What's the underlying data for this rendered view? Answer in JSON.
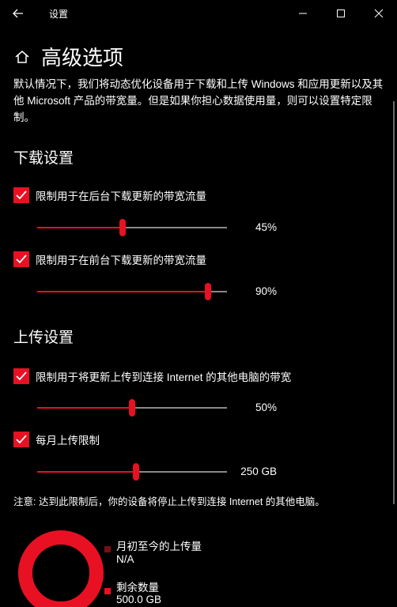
{
  "window": {
    "title": "设置"
  },
  "page": {
    "title": "高级选项",
    "description": "默认情况下，我们将动态优化设备用于下载和上传 Windows 和应用更新以及其他 Microsoft 产品的带宽量。但是如果你担心数据使用量，则可以设置特定限制。"
  },
  "download": {
    "section_title": "下载设置",
    "background": {
      "checked": true,
      "label": "限制用于在后台下载更新的带宽流量",
      "percent": 45,
      "value_text": "45%"
    },
    "foreground": {
      "checked": true,
      "label": "限制用于在前台下载更新的带宽流量",
      "percent": 90,
      "value_text": "90%"
    }
  },
  "upload": {
    "section_title": "上传设置",
    "bandwidth": {
      "checked": true,
      "label": "限制用于将更新上传到连接 Internet 的其他电脑的带宽",
      "percent": 50,
      "value_text": "50%"
    },
    "monthly": {
      "checked": true,
      "label": "每月上传限制",
      "fraction": 0.52,
      "value_text": "250 GB"
    },
    "note": "注意: 达到此限制后，你的设备将停止上传到连接 Internet 的其他电脑。"
  },
  "usage": {
    "uploaded_label": "月初至今的上传量",
    "uploaded_value": "N/A",
    "remaining_label": "剩余数量",
    "remaining_value": "500.0 GB"
  },
  "colors": {
    "accent": "#e81123",
    "uploaded_swatch": "#7a0f16",
    "track": "#8a8a8a",
    "background": "#000000"
  }
}
